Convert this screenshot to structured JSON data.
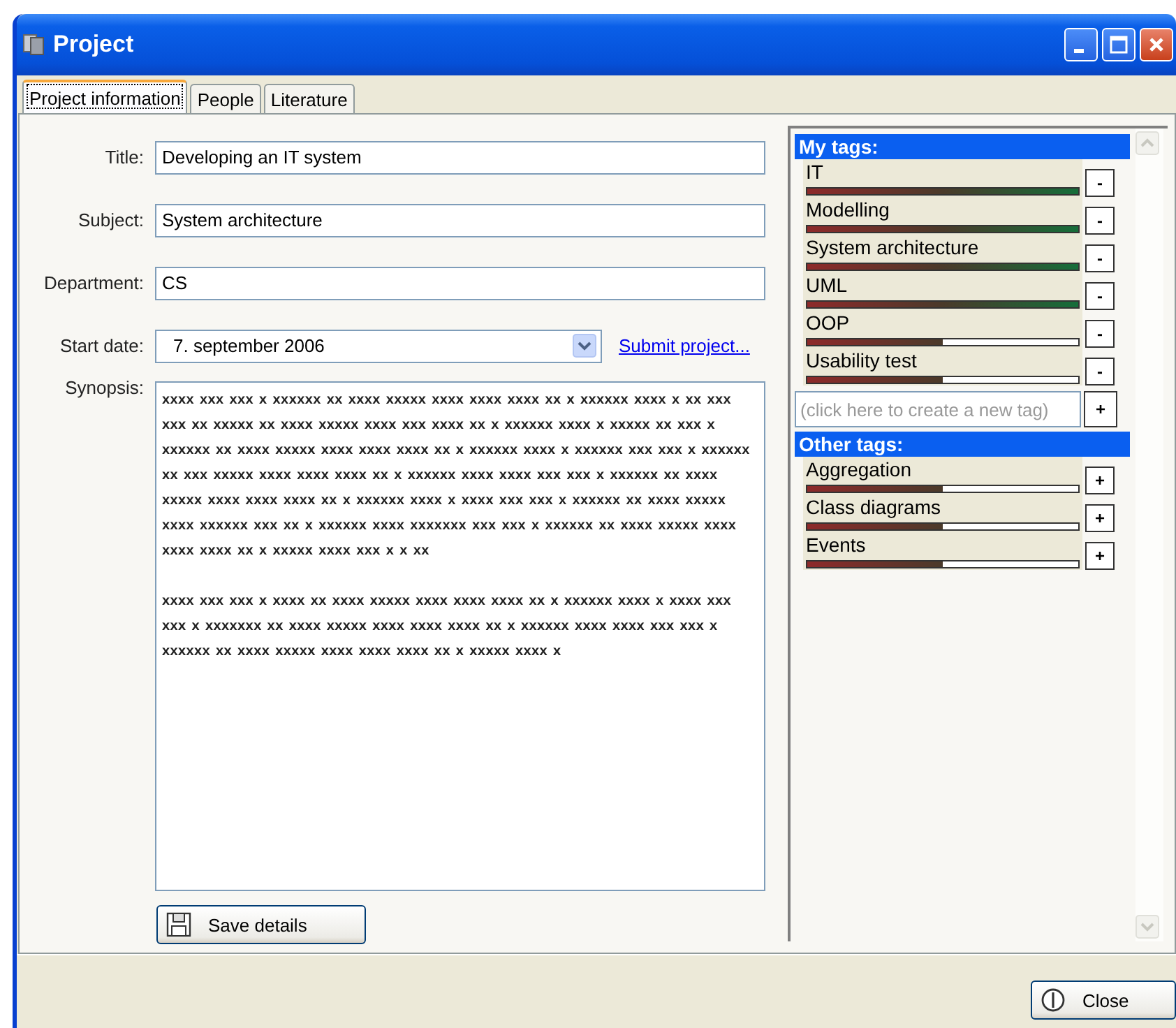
{
  "window": {
    "title": "Project"
  },
  "tabs": [
    {
      "label": "Project information",
      "selected": true
    },
    {
      "label": "People",
      "selected": false
    },
    {
      "label": "Literature",
      "selected": false
    }
  ],
  "form": {
    "fields": [
      {
        "label": "Title:",
        "value": "Developing an IT system"
      },
      {
        "label": "Subject:",
        "value": "System architecture"
      },
      {
        "label": "Department:",
        "value": "CS"
      }
    ],
    "start_date": {
      "label": "Start date:",
      "value": "7. september 2006"
    },
    "submit_link": "Submit project...",
    "synopsis": {
      "label": "Synopsis:",
      "paragraphs": [
        "xxxx xxx xxx x xxxxxx xx xxxx xxxxx xxxx xxxx xxxx xx x xxxxxx xxxx x xx xxx xxx xx xxxxx xx xxxx xxxxx xxxx xxx xxxx xx x xxxxxx xxxx x xxxxx xx xxx x xxxxxx xx xxxx xxxxx xxxx xxxx xxxx xx x xxxxxx xxxx x xxxxxx xxx xxx x xxxxxx xx xxx xxxxx xxxx xxxx xxxx xx x xxxxxx xxxx xxxx xxx xxx x xxxxxx xx xxxx xxxxx xxxx xxxx xxxx xx x xxxxxx xxxx x xxxx xxx xxx x xxxxxx xx xxxx xxxxx xxxx xxxxxx xxx xx x xxxxxx xxxx xxxxxxx xxx xxx x xxxxxx xx xxxx xxxxx xxxx xxxx xxxx xx x xxxxx xxxx xxx x x xx",
        "xxxx xxx xxx x xxxx xx xxxx xxxxx xxxx xxxx xxxx xx x xxxxxx xxxx x xxxx xxx xxx x xxxxxxx xx xxxx xxxxx xxxx xxxx xxxx xx x xxxxxx xxxx xxxx xxx xxx x xxxxxx xx xxxx xxxxx xxxx xxxx xxxx xx x xxxxx xxxx x"
      ]
    },
    "save_button": "Save details"
  },
  "tags": {
    "my_tags": {
      "heading": "My tags:",
      "items": [
        {
          "name": "IT",
          "level": 1,
          "button": "-"
        },
        {
          "name": "Modelling",
          "level": 1,
          "button": "-"
        },
        {
          "name": "System architecture",
          "level": 1,
          "button": "-"
        },
        {
          "name": "UML",
          "level": 1,
          "button": "-"
        },
        {
          "name": "OOP",
          "level": 0.5,
          "button": "-"
        },
        {
          "name": "Usability test",
          "level": 0.5,
          "button": "-"
        }
      ]
    },
    "new_tag": {
      "placeholder": "(click here to create a new tag)",
      "button": "+"
    },
    "other_tags": {
      "heading": "Other tags:",
      "items": [
        {
          "name": "Aggregation",
          "level": 0.5,
          "button": "+"
        },
        {
          "name": "Class diagrams",
          "level": 0.5,
          "button": "+"
        },
        {
          "name": "Events",
          "level": 0.5,
          "button": "+"
        }
      ]
    }
  },
  "close_button": "Close"
}
